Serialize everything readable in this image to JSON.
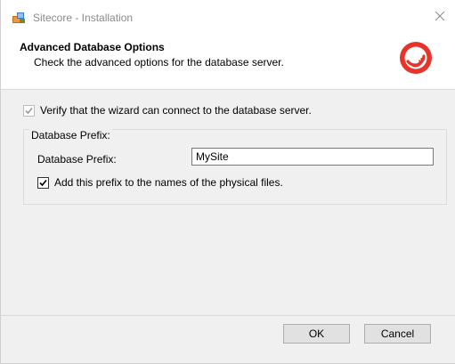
{
  "window": {
    "title": "Sitecore - Installation",
    "close_glyph": "✕"
  },
  "header": {
    "title": "Advanced Database Options",
    "subtitle": "Check the advanced options for the database server."
  },
  "options": {
    "verify_label": "Verify that the wizard can connect to the database server.",
    "verify_checked": true,
    "verify_disabled": true
  },
  "prefix_group": {
    "legend": "Database Prefix:",
    "field_label": "Database Prefix:",
    "field_value": "MySite",
    "add_prefix_label": "Add this prefix to the names of the physical files.",
    "add_prefix_checked": true
  },
  "footer": {
    "ok_label": "OK",
    "cancel_label": "Cancel"
  },
  "colors": {
    "brand_red": "#e8332a",
    "content_bg": "#f0f0f0"
  },
  "icons": {
    "app": "installer-icon",
    "logo": "sitecore-logo",
    "close": "close-icon",
    "check": "checkmark-icon"
  }
}
